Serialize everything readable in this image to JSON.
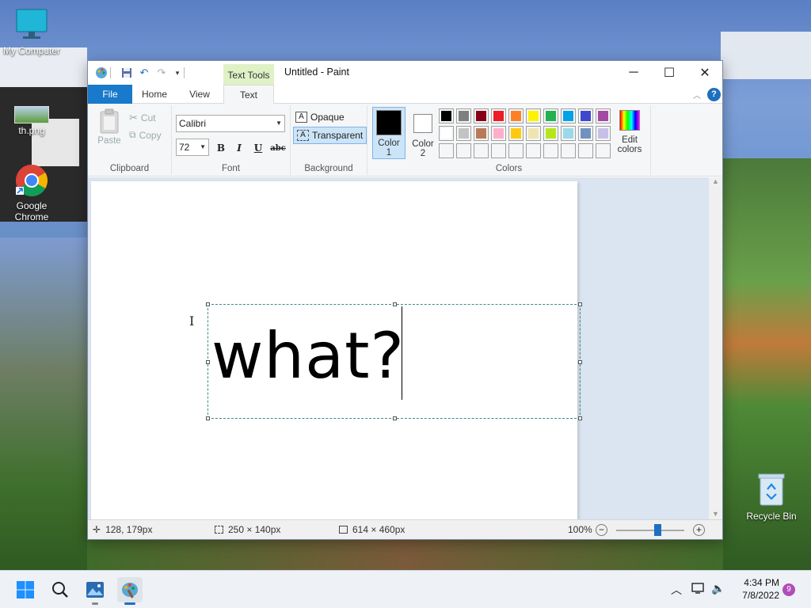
{
  "desktop": {
    "icons": [
      {
        "label": "My Computer",
        "icon": "monitor-icon"
      },
      {
        "label": "th.png",
        "icon": "image-thumbnail-icon"
      },
      {
        "label": "Google Chrome",
        "icon": "chrome-icon"
      },
      {
        "label": "Recycle Bin",
        "icon": "recycle-bin-icon"
      }
    ]
  },
  "window": {
    "title": "Untitled - Paint",
    "context_tab": "Text Tools",
    "controls": {
      "minimize": "─",
      "maximize": "☐",
      "close": "✕"
    }
  },
  "tabs": [
    {
      "label": "File",
      "active": false
    },
    {
      "label": "Home",
      "active": false
    },
    {
      "label": "View",
      "active": false
    },
    {
      "label": "Text",
      "active": true
    }
  ],
  "ribbon": {
    "clipboard": {
      "label": "Clipboard",
      "paste": "Paste",
      "cut": "Cut",
      "copy": "Copy"
    },
    "font": {
      "label": "Font",
      "family": "Calibri",
      "size": "72",
      "bold": "B",
      "italic": "I",
      "underline": "U",
      "strikethrough": "abc"
    },
    "background": {
      "label": "Background",
      "opaque": "Opaque",
      "transparent": "Transparent",
      "selected": "Transparent"
    },
    "colors": {
      "label": "Colors",
      "color1": "Color 1",
      "color2": "Color 2",
      "color1_value": "#000000",
      "color2_value": "#ffffff",
      "edit": "Edit colors",
      "palette_row1": [
        "#000000",
        "#7f7f7f",
        "#880015",
        "#ed1c24",
        "#ff7f27",
        "#fff200",
        "#22b14c",
        "#00a2e8",
        "#3f48cc",
        "#a349a4"
      ],
      "palette_row2": [
        "#ffffff",
        "#c3c3c3",
        "#b97a57",
        "#ffaec9",
        "#ffc90e",
        "#efe4b0",
        "#b5e61d",
        "#99d9ea",
        "#7092be",
        "#c8bfe7"
      ],
      "palette_row3": [
        "#f5f6f7",
        "#f5f6f7",
        "#f5f6f7",
        "#f5f6f7",
        "#f5f6f7",
        "#f5f6f7",
        "#f5f6f7",
        "#f5f6f7",
        "#f5f6f7",
        "#f5f6f7"
      ]
    }
  },
  "canvas": {
    "text": "what?"
  },
  "status": {
    "cursor": "128, 179px",
    "selection": "250 × 140px",
    "size": "614 × 460px",
    "zoom": "100%",
    "zoom_level": 0.6
  },
  "taskbar": {
    "time": "4:34 PM",
    "date": "7/8/2022",
    "notifications": "9"
  }
}
